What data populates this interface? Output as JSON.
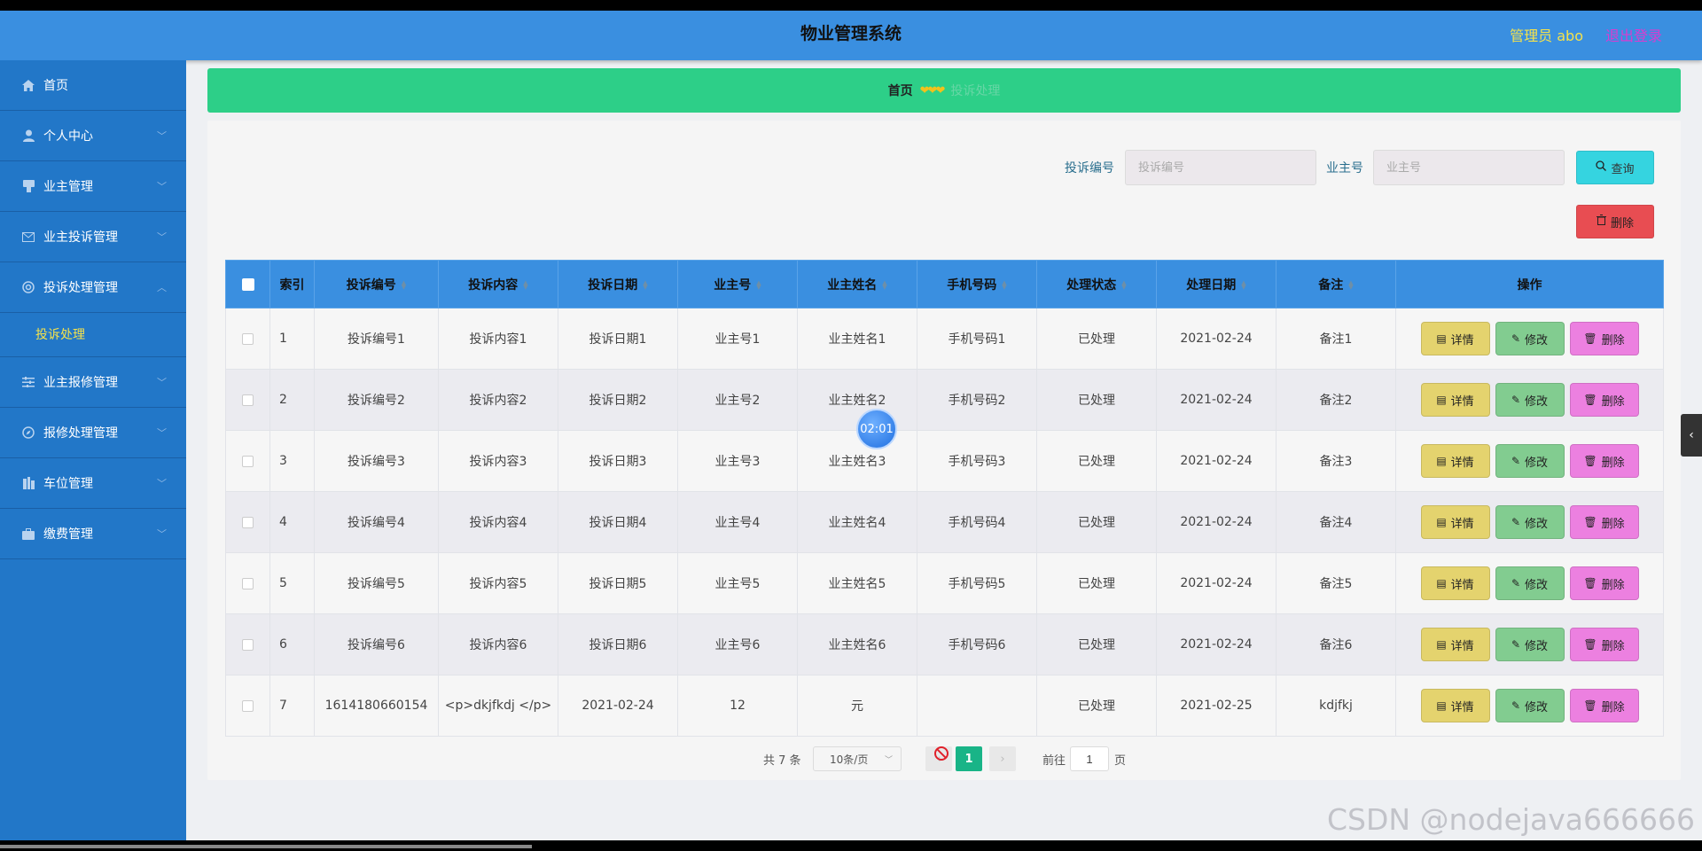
{
  "header": {
    "title": "物业管理系统",
    "user": "管理员 abo",
    "logout": "退出登录"
  },
  "sidebar": {
    "items": [
      {
        "label": "首页",
        "icon": "home-icon",
        "expandable": false
      },
      {
        "label": "个人中心",
        "icon": "user-icon",
        "expandable": true
      },
      {
        "label": "业主管理",
        "icon": "owner-icon",
        "expandable": true
      },
      {
        "label": "业主投诉管理",
        "icon": "mail-icon",
        "expandable": true
      },
      {
        "label": "投诉处理管理",
        "icon": "circle-icon",
        "expandable": true,
        "expanded": true
      },
      {
        "label": "业主报修管理",
        "icon": "sliders-icon",
        "expandable": true
      },
      {
        "label": "报修处理管理",
        "icon": "compass-icon",
        "expandable": true
      },
      {
        "label": "车位管理",
        "icon": "building-icon",
        "expandable": true
      },
      {
        "label": "缴费管理",
        "icon": "briefcase-icon",
        "expandable": true
      }
    ],
    "submenu": [
      {
        "label": "投诉处理"
      }
    ]
  },
  "breadcrumb": {
    "home": "首页",
    "separator": "❤❤❤",
    "current": "投诉处理"
  },
  "search": {
    "complaint_label": "投诉编号",
    "complaint_placeholder": "投诉编号",
    "owner_label": "业主号",
    "owner_placeholder": "业主号",
    "query_button": "查询",
    "delete_button": "删除"
  },
  "table": {
    "headers": [
      "索引",
      "投诉编号",
      "投诉内容",
      "投诉日期",
      "业主号",
      "业主姓名",
      "手机号码",
      "处理状态",
      "处理日期",
      "备注",
      "操作"
    ],
    "rows": [
      [
        "1",
        "投诉编号1",
        "投诉内容1",
        "投诉日期1",
        "业主号1",
        "业主姓名1",
        "手机号码1",
        "已处理",
        "2021-02-24",
        "备注1"
      ],
      [
        "2",
        "投诉编号2",
        "投诉内容2",
        "投诉日期2",
        "业主号2",
        "业主姓名2",
        "手机号码2",
        "已处理",
        "2021-02-24",
        "备注2"
      ],
      [
        "3",
        "投诉编号3",
        "投诉内容3",
        "投诉日期3",
        "业主号3",
        "业主姓名3",
        "手机号码3",
        "已处理",
        "2021-02-24",
        "备注3"
      ],
      [
        "4",
        "投诉编号4",
        "投诉内容4",
        "投诉日期4",
        "业主号4",
        "业主姓名4",
        "手机号码4",
        "已处理",
        "2021-02-24",
        "备注4"
      ],
      [
        "5",
        "投诉编号5",
        "投诉内容5",
        "投诉日期5",
        "业主号5",
        "业主姓名5",
        "手机号码5",
        "已处理",
        "2021-02-24",
        "备注5"
      ],
      [
        "6",
        "投诉编号6",
        "投诉内容6",
        "投诉日期6",
        "业主号6",
        "业主姓名6",
        "手机号码6",
        "已处理",
        "2021-02-24",
        "备注6"
      ],
      [
        "7",
        "1614180660154",
        "<p>dkjfkdj </p>",
        "2021-02-24",
        "12",
        "元",
        "",
        "已处理",
        "2021-02-25",
        "kdjfkj"
      ]
    ],
    "actions": {
      "detail": "详情",
      "edit": "修改",
      "delete": "删除"
    }
  },
  "pagination": {
    "total": "共 7 条",
    "page_size": "10条/页",
    "current_page": "1",
    "goto_label": "前往",
    "goto_value": "1",
    "page_suffix": "页"
  },
  "overlay": {
    "timer": "02:01",
    "watermark": "CSDN @nodejava666666"
  },
  "colors": {
    "header": "#3a8fe0",
    "sidebar": "#2277c8",
    "breadcrumb": "#2dcf88",
    "accent_yellow": "#f5e24b",
    "page_active": "#19b487"
  }
}
